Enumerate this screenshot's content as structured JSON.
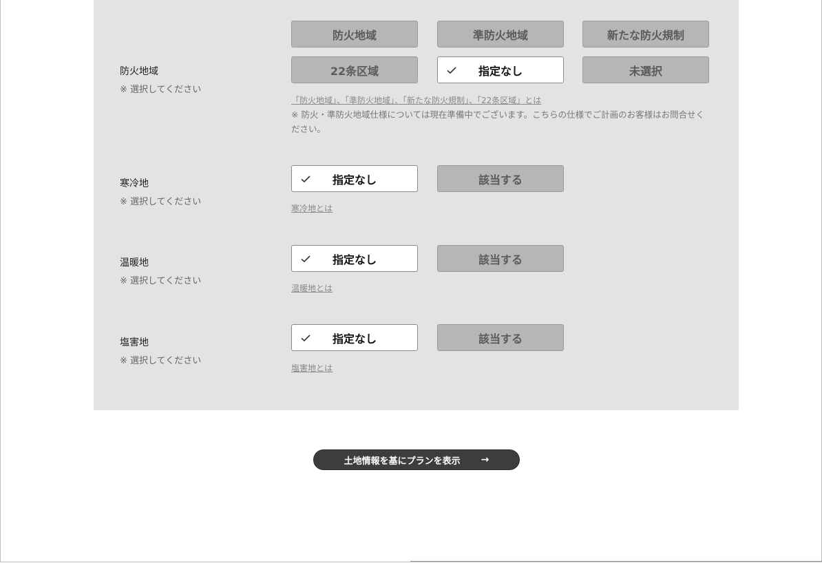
{
  "sections": [
    {
      "label": "防火地域",
      "sub": "※ 選択してください",
      "options": [
        "防火地域",
        "準防火地域",
        "新たな防火規制",
        "22条区域",
        "指定なし",
        "未選択"
      ],
      "selected": "指定なし",
      "link": "「防火地域」、「準防火地域」、「新たな防火規制」、「22条区域」とは",
      "note": "※ 防火・準防火地域仕様については現在準備中でございます。こちらの仕様でご計画のお客様はお問合せください。"
    },
    {
      "label": "寒冷地",
      "sub": "※ 選択してください",
      "options": [
        "指定なし",
        "該当する"
      ],
      "selected": "指定なし",
      "link": "寒冷地とは"
    },
    {
      "label": "温暖地",
      "sub": "※ 選択してください",
      "options": [
        "指定なし",
        "該当する"
      ],
      "selected": "指定なし",
      "link": "温暖地とは"
    },
    {
      "label": "塩害地",
      "sub": "※ 選択してください",
      "options": [
        "指定なし",
        "該当する"
      ],
      "selected": "指定なし",
      "link": "塩害地とは"
    }
  ],
  "submit": {
    "label": "土地情報を基にプランを表示",
    "arrow": "→"
  },
  "colors": {
    "panel_bg": "#e3e3e3",
    "option_bg": "#b6b6b6",
    "option_selected_bg": "#ffffff",
    "cta_bg": "#3d3d3d"
  },
  "icons": {
    "check": "check-icon",
    "arrow": "arrow-right-icon"
  }
}
